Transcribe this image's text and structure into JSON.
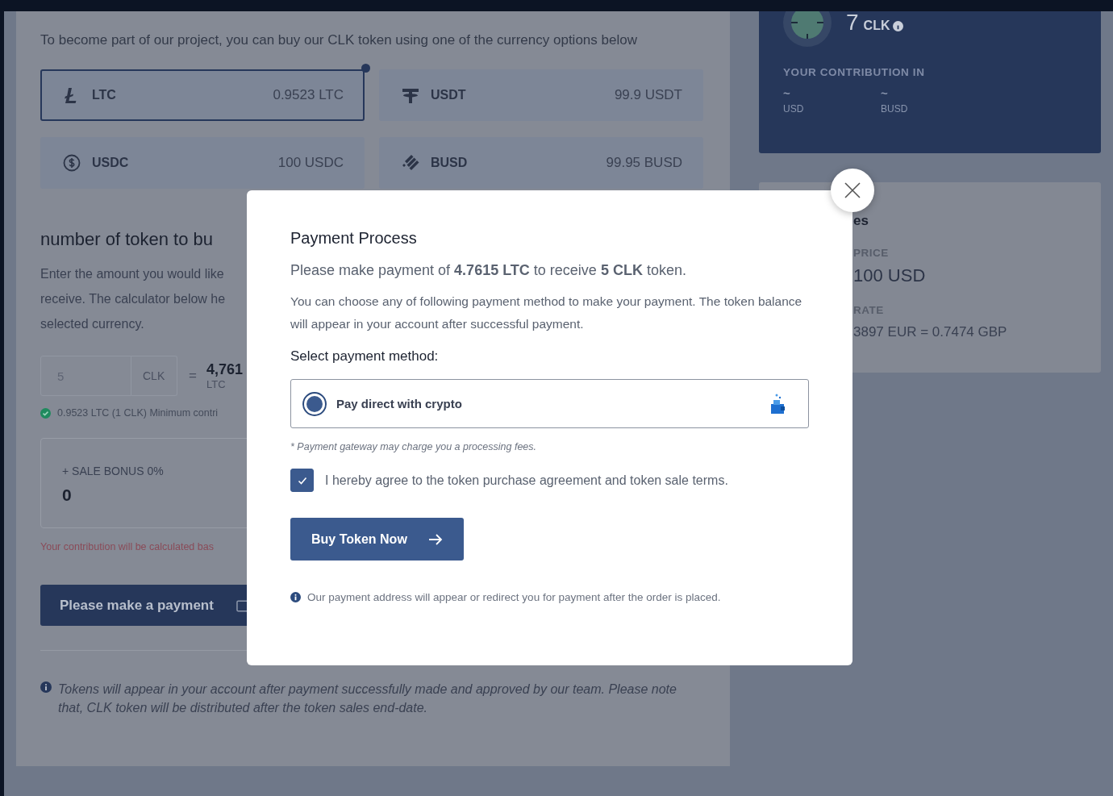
{
  "intro": "To become part of our project, you can buy our CLK token using one of the currency options below",
  "currencies": [
    {
      "kind": "ltc",
      "code": "LTC",
      "amount": "0.9523 LTC",
      "selected": true
    },
    {
      "kind": "usdt",
      "code": "USDT",
      "amount": "99.9 USDT",
      "selected": false
    },
    {
      "kind": "usdc",
      "code": "USDC",
      "amount": "100 USDC",
      "selected": false
    },
    {
      "kind": "busd",
      "code": "BUSD",
      "amount": "99.95 BUSD",
      "selected": false
    }
  ],
  "amount_section": {
    "heading": "number of token to bu",
    "description_lines": [
      "Enter the amount you would like",
      "receive. The calculator below he",
      "selected currency."
    ],
    "token_input": {
      "placeholder": "5",
      "unit": "CLK"
    },
    "equals": "=",
    "result": "4,761",
    "result_unit": "LTC",
    "minimum_note": "0.9523 LTC (1 CLK) Minimum contri",
    "bonus": {
      "label": "+ SALE BONUS 0%",
      "value": "0"
    },
    "warning": "Your contribution will be calculated bas",
    "pay_button": "Please make a payment"
  },
  "footer_note": "Tokens will appear in your account after payment successfully made and approved by our team. Please note that, CLK token will be distributed after the token sales end-date.",
  "balance_card": {
    "amount": "7",
    "unit": "CLK",
    "contribution_label": "YOUR CONTRIBUTION IN",
    "contributions": [
      {
        "value": "~",
        "currency": "USD"
      },
      {
        "value": "~",
        "currency": "BUSD"
      }
    ]
  },
  "price_card": {
    "heading": "es",
    "price_label": "PRICE",
    "price": "100 USD",
    "rate_label": "RATE",
    "rate": "3897 EUR = 0.7474 GBP"
  },
  "modal": {
    "title": "Payment Process",
    "summary": "Please make payment of **4.7615 LTC** to receive **5 CLK** token.",
    "description": "You can choose any of following payment method to make your payment. The token balance will appear in your account after successful payment.",
    "method_label": "Select payment method:",
    "payment_methods": [
      {
        "label": "Pay direct with crypto",
        "selected": true
      }
    ],
    "fee_note": "* Payment gateway may charge you a processing fees.",
    "agreement": {
      "text": "I hereby agree to the token purchase agreement and token sale terms.",
      "checked": true
    },
    "buy_button": "Buy Token Now",
    "address_note": "Our payment address will appear or redirect you for payment after the order is placed."
  }
}
